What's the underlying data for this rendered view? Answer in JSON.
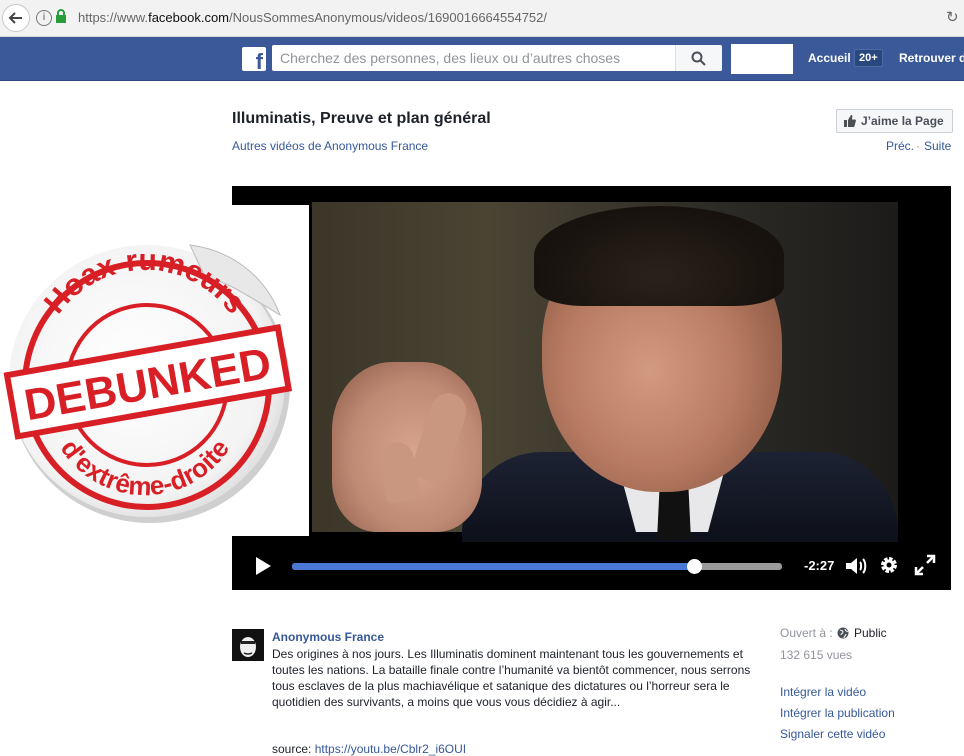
{
  "browser": {
    "url_prefix": "https://www.",
    "url_domain": "facebook.com",
    "url_path": "/NousSommesAnonymous/videos/1690016664554752/"
  },
  "fb_header": {
    "search_placeholder": "Cherchez des personnes, des lieux ou d’autres choses",
    "home_label": "Accueil",
    "home_badge": "20+",
    "friends_label": "Retrouver d"
  },
  "video": {
    "title": "Illuminatis, Preuve et plan général",
    "like_page_label": "J’aime la Page",
    "more_videos_label": "Autres vidéos de Anonymous France",
    "prev_label": "Préc.",
    "separator": "·",
    "next_label": "Suite",
    "time_remaining": "-2:27",
    "progress_fraction": 0.82
  },
  "sticker": {
    "top_text": "Hoax-rumeurs",
    "center_text": "DEBUNKED",
    "bottom_text": "d'extrême-droite",
    "color": "#d81f26"
  },
  "post": {
    "author": "Anonymous France",
    "text": "Des origines à nos jours. Les Illuminatis dominent maintenant tous les gouvernements et toutes les nations. La bataille finale contre l’humanité va bientôt commencer, nous serrons tous esclaves de la plus machiavélique et satanique des dictatures ou l’horreur sera le quotidien des survivants, a moins que vous vous décidiez à agir...",
    "source_label": "source:",
    "source_link": "https://youtu.be/Cblr2_i6OUI"
  },
  "meta": {
    "opened_label": "Ouvert à :",
    "audience": "Public",
    "views": "132 615 vues",
    "links": [
      "Intégrer la vidéo",
      "Intégrer la publication",
      "Signaler cette vidéo"
    ]
  },
  "colors": {
    "fb_blue": "#3b5998",
    "link_blue": "#365899",
    "progress_blue": "#4a76d4"
  }
}
